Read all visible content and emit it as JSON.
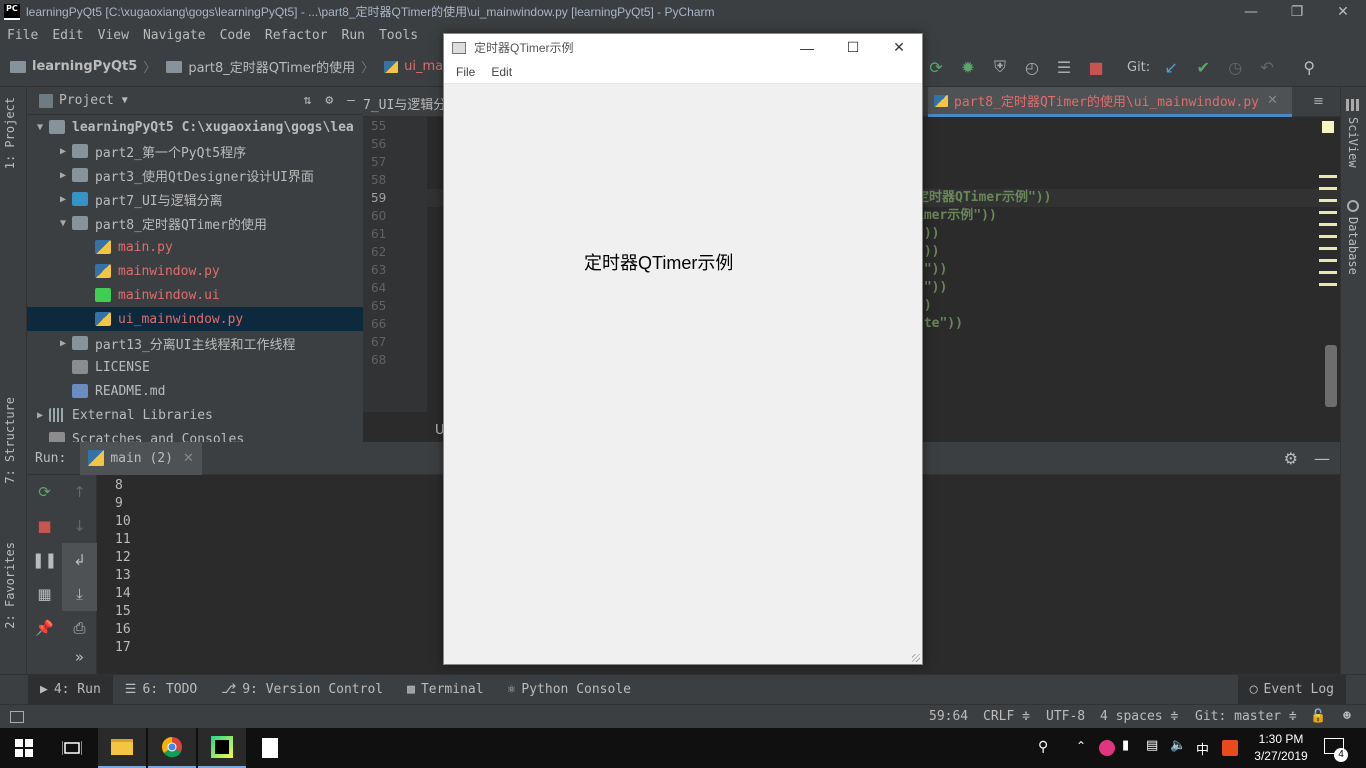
{
  "window": {
    "title": "learningPyQt5 [C:\\xugaoxiang\\gogs\\learningPyQt5] - ...\\part8_定时器QTimer的使用\\ui_mainwindow.py [learningPyQt5] - PyCharm"
  },
  "menu": [
    "File",
    "Edit",
    "View",
    "Navigate",
    "Code",
    "Refactor",
    "Run",
    "Tools"
  ],
  "navbar": {
    "crumbs": [
      "learningPyQt5",
      "part8_定时器QTimer的使用",
      "ui_ma"
    ],
    "git_label": "Git:"
  },
  "left_stripe": {
    "project_tab": "1: Project",
    "structure_tab": "7: Structure",
    "favorites_tab": "2: Favorites"
  },
  "right_stripe": {
    "sciview_tab": "SciView",
    "database_tab": "Database"
  },
  "project_panel": {
    "header": "Project",
    "tree": [
      {
        "label": "learningPyQt5  C:\\xugaoxiang\\gogs\\lea",
        "indent": 0,
        "arrow": "▼",
        "icon": "folder",
        "color": "normal",
        "bold": true
      },
      {
        "label": "part2_第一个PyQt5程序",
        "indent": 1,
        "arrow": "▶",
        "icon": "folder",
        "color": "normal"
      },
      {
        "label": "part3_使用QtDesigner设计UI界面",
        "indent": 1,
        "arrow": "▶",
        "icon": "folder",
        "color": "normal"
      },
      {
        "label": "part7_UI与逻辑分离",
        "indent": 1,
        "arrow": "▶",
        "icon": "folder-blue",
        "color": "normal"
      },
      {
        "label": "part8_定时器QTimer的使用",
        "indent": 1,
        "arrow": "▼",
        "icon": "folder",
        "color": "normal"
      },
      {
        "label": "main.py",
        "indent": 2,
        "arrow": "",
        "icon": "py",
        "color": "red"
      },
      {
        "label": "mainwindow.py",
        "indent": 2,
        "arrow": "",
        "icon": "py",
        "color": "red"
      },
      {
        "label": "mainwindow.ui",
        "indent": 2,
        "arrow": "",
        "icon": "ui",
        "color": "red"
      },
      {
        "label": "ui_mainwindow.py",
        "indent": 2,
        "arrow": "",
        "icon": "py",
        "color": "red",
        "selected": true
      },
      {
        "label": "part13_分离UI主线程和工作线程",
        "indent": 1,
        "arrow": "▶",
        "icon": "folder",
        "color": "normal"
      },
      {
        "label": "LICENSE",
        "indent": 1,
        "arrow": "",
        "icon": "file",
        "color": "normal"
      },
      {
        "label": "README.md",
        "indent": 1,
        "arrow": "",
        "icon": "md",
        "color": "normal"
      },
      {
        "label": "External Libraries",
        "indent": 0,
        "arrow": "▶",
        "icon": "lib",
        "color": "normal"
      },
      {
        "label": "Scratches and Consoles",
        "indent": 0,
        "arrow": "",
        "icon": "file",
        "color": "normal"
      }
    ]
  },
  "editor": {
    "tab_left_partial": "7_UI与逻辑分",
    "active_tab": "part8_定时器QTimer的使用\\ui_mainwindow.py",
    "line_numbers": [
      "55",
      "56",
      "57",
      "58",
      "59",
      "60",
      "61",
      "62",
      "63",
      "64",
      "65",
      "66",
      "67",
      "68"
    ],
    "current_line": "59",
    "status_partial": "U",
    "code_fragments": [
      {
        "text": "定时器QTimer示例\"))",
        "line": 4
      },
      {
        "text": "imer示例\"))",
        "line": 5
      },
      {
        "text": "\"))",
        "line": 6
      },
      {
        "text": "\"))",
        "line": 7
      },
      {
        "text": "t\"))",
        "line": 8
      },
      {
        "text": "y\"))",
        "line": 9
      },
      {
        "text": "))",
        "line": 10
      },
      {
        "text": "ste\"))",
        "line": 11
      }
    ]
  },
  "run_panel": {
    "label": "Run:",
    "tab": "main (2)",
    "output": [
      "8",
      "9",
      "10",
      "11",
      "12",
      "13",
      "14",
      "15",
      "16",
      "17"
    ]
  },
  "tool_tabs": [
    {
      "label": "4: Run",
      "icon": "run-icon",
      "active": true
    },
    {
      "label": "6: TODO",
      "icon": "todo-icon"
    },
    {
      "label": "9: Version Control",
      "icon": "vcs-icon"
    },
    {
      "label": "Terminal",
      "icon": "terminal-icon"
    },
    {
      "label": "Python Console",
      "icon": "python-icon"
    }
  ],
  "event_log": "Event Log",
  "status": {
    "position": "59:64",
    "line_sep": "CRLF ≑",
    "encoding": "UTF-8",
    "indent": "4 spaces ≑",
    "git": "Git: master ≑"
  },
  "qt_window": {
    "title": "定时器QTimer示例",
    "menu": [
      "File",
      "Edit"
    ],
    "label": "定时器QTimer示例"
  },
  "taskbar": {
    "time": "1:30 PM",
    "date": "3/27/2019",
    "ime": "中",
    "notifications": "4"
  },
  "colors": {
    "ide_bg": "#3c3f41",
    "editor_bg": "#2b2b2b",
    "code_string": "#6a8759",
    "vcs_modified": "#e06c6c",
    "selection": "#0d293e"
  }
}
